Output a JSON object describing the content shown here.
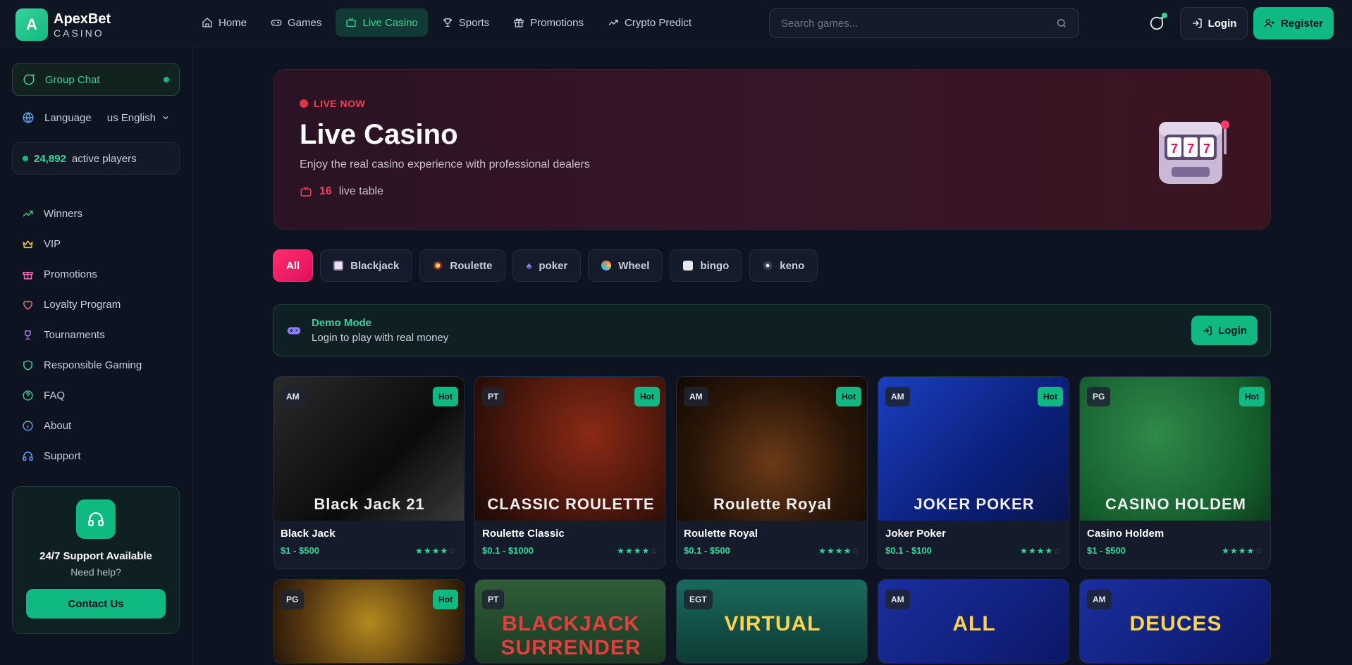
{
  "brand": {
    "initial": "A",
    "name": "ApexBet",
    "sub": "CASINO"
  },
  "nav": [
    {
      "label": "Home",
      "icon": "home-icon"
    },
    {
      "label": "Games",
      "icon": "gamepad-icon"
    },
    {
      "label": "Live Casino",
      "icon": "tv-icon",
      "active": true
    },
    {
      "label": "Sports",
      "icon": "trophy-icon"
    },
    {
      "label": "Promotions",
      "icon": "gift-icon"
    },
    {
      "label": "Crypto Predict",
      "icon": "trending-icon"
    }
  ],
  "search": {
    "placeholder": "Search games..."
  },
  "header": {
    "login": "Login",
    "register": "Register"
  },
  "sidebar": {
    "group_chat": "Group Chat",
    "language_label": "Language",
    "language_value": "us English",
    "active_count": "24,892",
    "active_label": "active players",
    "items": [
      {
        "label": "Winners",
        "icon": "trending-icon",
        "color": "#34d399"
      },
      {
        "label": "VIP",
        "icon": "crown-icon",
        "color": "#facc15"
      },
      {
        "label": "Promotions",
        "icon": "gift-icon",
        "color": "#f472b6"
      },
      {
        "label": "Loyalty Program",
        "icon": "heart-icon",
        "color": "#fb7185"
      },
      {
        "label": "Tournaments",
        "icon": "trophy-icon",
        "color": "#a78bfa"
      },
      {
        "label": "Responsible Gaming",
        "icon": "shield-icon",
        "color": "#34d399"
      },
      {
        "label": "FAQ",
        "icon": "help-circle-icon",
        "color": "#34d399"
      },
      {
        "label": "About",
        "icon": "info-icon",
        "color": "#60a5fa"
      },
      {
        "label": "Support",
        "icon": "headphones-icon",
        "color": "#60a5fa"
      }
    ],
    "support_title": "24/7 Support Available",
    "support_sub": "Need help?",
    "contact": "Contact Us"
  },
  "hero": {
    "badge": "LIVE NOW",
    "title": "Live Casino",
    "subtitle": "Enjoy the real casino experience with professional dealers",
    "tables_count": "16",
    "tables_label": "live table"
  },
  "filters": [
    {
      "label": "All",
      "active": true
    },
    {
      "label": "Blackjack",
      "icon": "card-icon"
    },
    {
      "label": "Roulette",
      "icon": "roulette-icon"
    },
    {
      "label": "poker",
      "icon": "spade-icon"
    },
    {
      "label": "Wheel",
      "icon": "wheel-icon"
    },
    {
      "label": "bingo",
      "icon": "dice-icon"
    },
    {
      "label": "keno",
      "icon": "ball-icon"
    }
  ],
  "demo": {
    "title": "Demo Mode",
    "subtitle": "Login to play with real money",
    "login": "Login"
  },
  "games": [
    {
      "name": "Black Jack",
      "limits": "$1 - $500",
      "provider": "AM",
      "hot": "Hot",
      "stars": 4,
      "thumb_text": "Black Jack 21",
      "bg": "linear-gradient(135deg,#2a2a2a,#0b0b0b 60%,#3a3a3a)"
    },
    {
      "name": "Roulette Classic",
      "limits": "$0.1 - $1000",
      "provider": "PT",
      "hot": "Hot",
      "stars": 4,
      "thumb_text": "CLASSIC ROULETTE",
      "bg": "radial-gradient(circle at 60% 40%,#8b2a14,#3a120a 70%,#1c0a05)"
    },
    {
      "name": "Roulette Royal",
      "limits": "$0.1 - $500",
      "provider": "AM",
      "hot": "Hot",
      "stars": 4,
      "thumb_text": "Roulette Royal",
      "bg": "radial-gradient(circle at 50% 60%,#6b3a16,#2a1608 60%,#120904)"
    },
    {
      "name": "Joker Poker",
      "limits": "$0.1 - $100",
      "provider": "AM",
      "hot": "Hot",
      "stars": 4,
      "thumb_text": "JOKER POKER",
      "bg": "linear-gradient(135deg,#1a3fbf,#0a1f7a 60%,#0a154f)"
    },
    {
      "name": "Casino Holdem",
      "limits": "$1 - $500",
      "provider": "PG",
      "hot": "Hot",
      "stars": 4,
      "thumb_text": "CASINO HOLDEM",
      "bg": "radial-gradient(circle at 40% 40%,#2f8a4a,#145d2c 70%,#0c3a1b)"
    },
    {
      "name": "",
      "limits": "",
      "provider": "PG",
      "hot": "Hot",
      "stars": 0,
      "thumb_text": "",
      "bg": "radial-gradient(circle at 50% 50%,#b38a1f,#5a3a10 60%,#241608)"
    },
    {
      "name": "",
      "limits": "",
      "provider": "PT",
      "hot": "",
      "stars": 0,
      "thumb_text": "BLACKJACK SURRENDER",
      "bg": "linear-gradient(180deg,#2f5d38,#1a3a22)"
    },
    {
      "name": "",
      "limits": "",
      "provider": "EGT",
      "hot": "",
      "stars": 0,
      "thumb_text": "VIRTUAL",
      "bg": "linear-gradient(180deg,#1a6a5e,#0d3a34)"
    },
    {
      "name": "",
      "limits": "",
      "provider": "AM",
      "hot": "",
      "stars": 0,
      "thumb_text": "ALL",
      "bg": "linear-gradient(135deg,#1a2f9f,#0b1766)"
    },
    {
      "name": "",
      "limits": "",
      "provider": "AM",
      "hot": "",
      "stars": 0,
      "thumb_text": "DEUCES",
      "bg": "linear-gradient(135deg,#1a2f9f,#0b1766)"
    }
  ]
}
